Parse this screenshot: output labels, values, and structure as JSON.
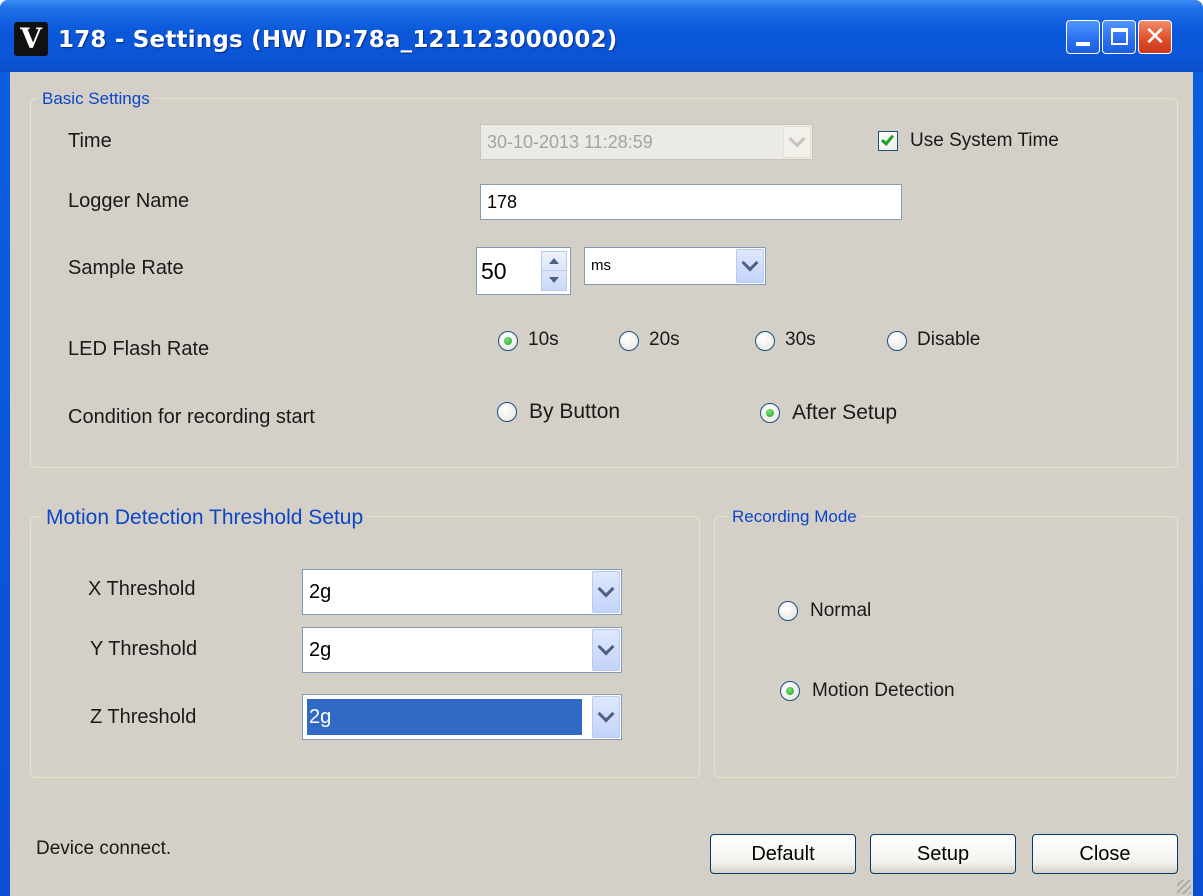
{
  "window": {
    "title": "178 - Settings (HW ID:78a_121123000002)",
    "icon_letter": "V",
    "close_glyph": "✕"
  },
  "basic_settings": {
    "title": "Basic Settings",
    "time_label": "Time",
    "time_value": "30-10-2013 11:28:59",
    "use_system_time_label": "Use System Time",
    "use_system_time_checked": true,
    "logger_name_label": "Logger Name",
    "logger_name_value": "178",
    "sample_rate_label": "Sample Rate",
    "sample_rate_value": "50",
    "sample_rate_unit": "ms",
    "led_flash_label": "LED Flash Rate",
    "led_options": [
      "10s",
      "20s",
      "30s",
      "Disable"
    ],
    "led_selected": "10s",
    "condition_label": "Condition for recording start",
    "condition_options": [
      "By Button",
      "After Setup"
    ],
    "condition_selected": "After Setup"
  },
  "motion": {
    "title": "Motion Detection Threshold Setup",
    "x_label": "X Threshold",
    "x_value": "2g",
    "y_label": "Y Threshold",
    "y_value": "2g",
    "z_label": "Z Threshold",
    "z_value": "2g"
  },
  "recording_mode": {
    "title": "Recording Mode",
    "options": [
      "Normal",
      "Motion Detection"
    ],
    "selected": "Motion Detection"
  },
  "footer": {
    "status": "Device connect.",
    "default_label": "Default",
    "setup_label": "Setup",
    "close_label": "Close"
  },
  "colors": {
    "titlebar": "#0a57da",
    "dialog_bg": "#d4d0c8",
    "group_title": "#0b46c8",
    "selection": "#316ac5",
    "radio_dot": "#21a121"
  },
  "icons": [
    "app-v-icon",
    "minimize-icon",
    "maximize-icon",
    "close-icon",
    "dropdown-arrow-icon",
    "spin-up-icon",
    "spin-down-icon",
    "resize-grip-icon"
  ]
}
